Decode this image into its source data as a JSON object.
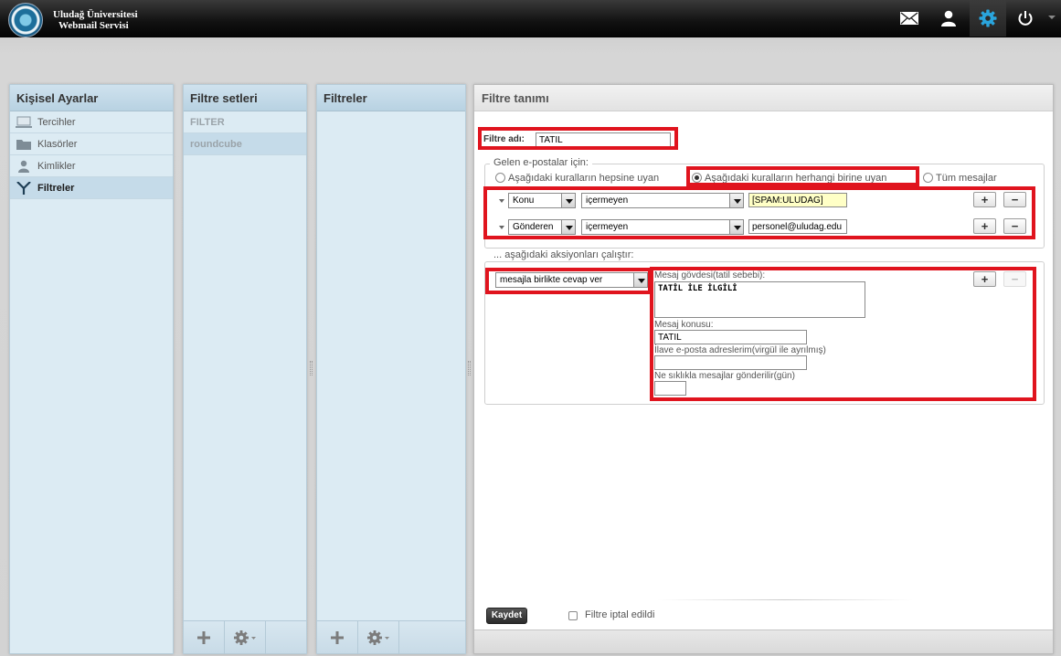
{
  "header": {
    "title_line1": "Uludağ Üniversitesi",
    "title_line2": "Webmail Servisi",
    "icons": [
      "mail-icon",
      "user-icon",
      "gear-icon",
      "power-icon"
    ]
  },
  "personal_settings": {
    "title": "Kişisel Ayarlar",
    "items": [
      {
        "label": "Tercihler",
        "icon": "computer-icon"
      },
      {
        "label": "Klasörler",
        "icon": "folder-icon"
      },
      {
        "label": "Kimlikler",
        "icon": "person-icon"
      },
      {
        "label": "Filtreler",
        "icon": "filter-icon",
        "selected": true
      }
    ]
  },
  "filter_sets": {
    "title": "Filtre setleri",
    "items": [
      {
        "label": "FILTER"
      },
      {
        "label": "roundcube",
        "selected": true
      }
    ]
  },
  "filters": {
    "title": "Filtreler"
  },
  "filter_definition": {
    "title": "Filtre tanımı",
    "name_label": "Filtre adı:",
    "name_value": "TATİL",
    "incoming_legend": "Gelen e-postalar için:",
    "match_options": [
      {
        "label": "Aşağıdaki kuralların hepsine uyan",
        "checked": false
      },
      {
        "label": "Aşağıdaki kuralların herhangi birine uyan",
        "checked": true
      },
      {
        "label": "Tüm mesajlar",
        "checked": false
      }
    ],
    "rules": [
      {
        "header": "Konu",
        "operator": "içermeyen",
        "value": "[SPAM:ULUDAG]"
      },
      {
        "header": "Gönderen",
        "operator": "içermeyen",
        "value": "personel@uludag.edu"
      }
    ],
    "actions_legend": "... aşağıdaki aksiyonları çalıştır:",
    "action": "mesajla birlikte cevap ver",
    "body_label": "Mesaj gövdesi(tatil sebebi):",
    "body_value": "TATİL İLE İLGİLİ",
    "subject_label": "Mesaj konusu:",
    "subject_value": "TATİL",
    "addresses_label": "İlave e-posta adreslerim(virgül ile ayrılmış)",
    "addresses_value": "",
    "days_label": "Ne sıklıkla mesajlar gönderilir(gün)",
    "days_value": "",
    "save_button": "Kaydet",
    "disabled_label": "Filtre iptal edildi",
    "add_symbol": "+",
    "remove_symbol": "−"
  },
  "colors": {
    "highlight_box": "#e0141e",
    "panel_bg": "#dcebf3",
    "topbar": "#111111"
  }
}
